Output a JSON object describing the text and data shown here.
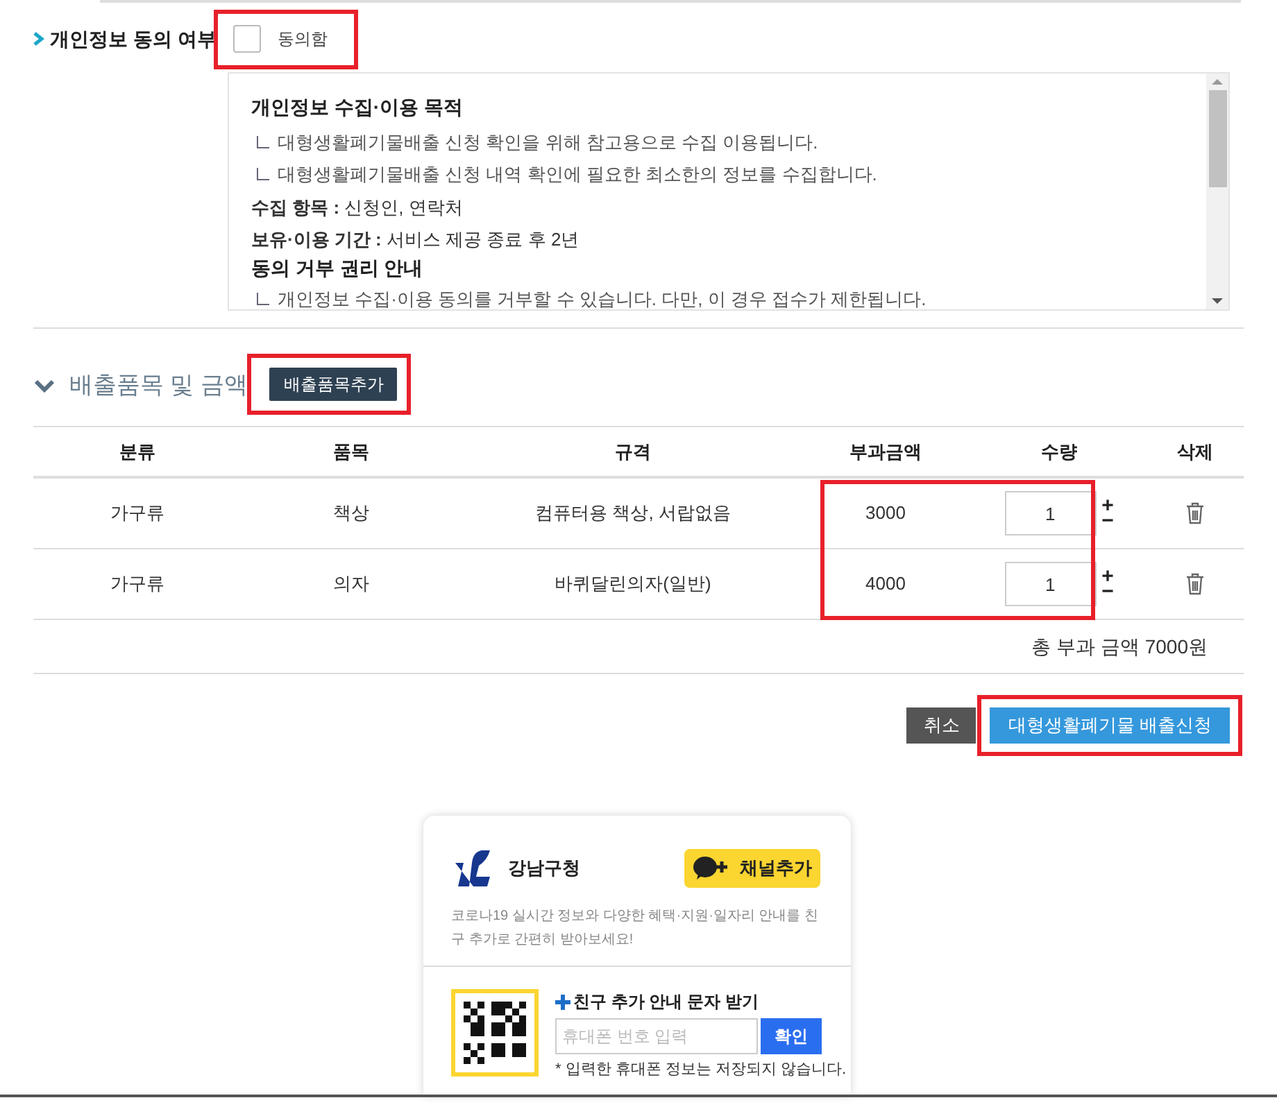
{
  "consent": {
    "label": "개인정보 동의 여부",
    "checkbox_label": "동의함",
    "checked": false,
    "highlighted": true,
    "notice": [
      {
        "kind": "heading",
        "text": "개인정보 수집·이용 목적"
      },
      {
        "kind": "bullet",
        "text": "대형생활폐기물배출 신청 확인을 위해 참고용으로 수집 이용됩니다."
      },
      {
        "kind": "bullet",
        "text": "대형생활폐기물배출 신청 내역 확인에 필요한 최소한의 정보를 수집합니다."
      },
      {
        "kind": "field",
        "text": "**수집 항목 :** 신청인, 연락처"
      },
      {
        "kind": "field",
        "text": "**보유·이용 기간 :** 서비스 제공 종료 후 2년"
      },
      {
        "kind": "heading",
        "text": "동의 거부 권리 안내"
      },
      {
        "kind": "bullet",
        "text": "개인정보 수집·이용 동의를 거부할 수 있습니다. 다만, 이 경우 접수가 제한됩니다."
      }
    ]
  },
  "items_section": {
    "title": "배출품목 및 금액",
    "expanded": true,
    "add_button": {
      "label": "배출품목추가",
      "highlighted": true
    },
    "table": {
      "columns": [
        "분류",
        "품목",
        "규격",
        "부과금액",
        "수량",
        "삭제"
      ],
      "highlight_price_quantity": true,
      "rows": [
        {
          "category": "가구류",
          "item": "책상",
          "spec": "컴퓨터용 책상, 서랍없음",
          "fee": "3000",
          "quantity": "1",
          "increment": "+",
          "decrement": "−"
        },
        {
          "category": "가구류",
          "item": "의자",
          "spec": "바퀴달린의자(일반)",
          "fee": "4000",
          "quantity": "1",
          "increment": "+",
          "decrement": "−"
        }
      ],
      "total": "총 부과 금액 7000원"
    }
  },
  "actions": {
    "cancel": "취소",
    "submit": {
      "label": "대형생활폐기물 배출신청",
      "highlighted": true
    }
  },
  "kakao_card": {
    "org_name": "강남구청",
    "channel_button": "채널추가",
    "description": "코로나19 실시간 정보와 다양한 혜택·지원·일자리 안내를 친구 추가로 간편히 받아보세요!",
    "sms_title": "친구 추가 안내 문자 받기",
    "phone_placeholder": "휴대폰 번호 입력",
    "confirm_button": "확인",
    "note": "* 입력한 휴대폰 정보는 저장되지 않습니다."
  }
}
